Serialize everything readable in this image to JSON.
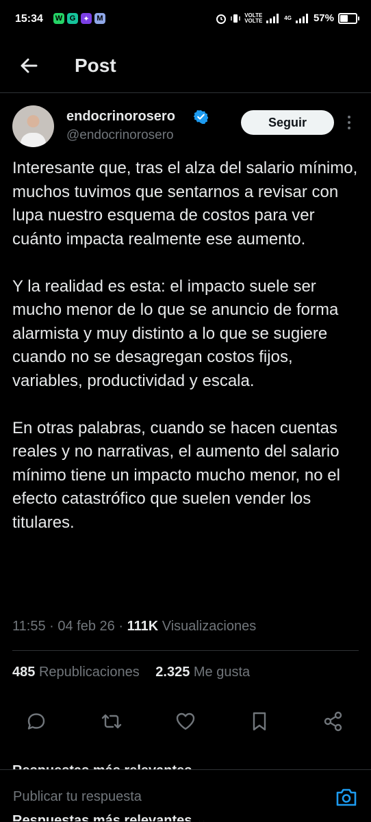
{
  "status_bar": {
    "time": "15:34",
    "apps": [
      {
        "icon": "whatsapp-icon",
        "glyph": "W",
        "color": "#25d366"
      },
      {
        "icon": "grammarly-icon",
        "glyph": "G",
        "color": "#15c39a"
      },
      {
        "icon": "chat-app-icon",
        "glyph": "✦",
        "color": "#7b3fe4"
      },
      {
        "icon": "mail-icon",
        "glyph": "M",
        "color": "#8fa7e8"
      }
    ],
    "volte1": "VOLTE",
    "volte2": "VOLTE",
    "network": "4G",
    "battery": "57%",
    "battery_level": 0.57
  },
  "header": {
    "title": "Post"
  },
  "author": {
    "display_name": "endocrinorosero",
    "handle": "@endocrinorosero",
    "follow_label": "Seguir"
  },
  "post": {
    "paragraphs": [
      "Interesante que, tras el alza del salario mínimo, muchos tuvimos que sentarnos a revisar con lupa nuestro esquema de costos para ver cuánto impacta realmente ese aumento.",
      "Y la realidad es esta: el impacto suele ser mucho menor de lo que se anuncio de forma alarmista y muy distinto a lo que se sugiere cuando no se desagregan costos fijos, variables, productividad y escala.",
      "En otras palabras, cuando se hacen cuentas reales y no narrativas, el aumento del salario mínimo tiene un impacto mucho menor, no el efecto catastrófico que suelen vender los titulares."
    ],
    "time": "11:55",
    "date": "04 feb 26",
    "views_count": "111K",
    "views_label": "Visualizaciones"
  },
  "stats": {
    "reposts_count": "485",
    "reposts_label": "Republicaciones",
    "likes_count": "2.325",
    "likes_label": "Me gusta"
  },
  "replies": {
    "sort_label": "Respuestas más relevantes",
    "placeholder": "Publicar tu respuesta"
  },
  "colors": {
    "background": "#000000",
    "text": "#e7e9ea",
    "secondary": "#71767b",
    "accent": "#1d9bf0",
    "divider": "#2f3336"
  }
}
